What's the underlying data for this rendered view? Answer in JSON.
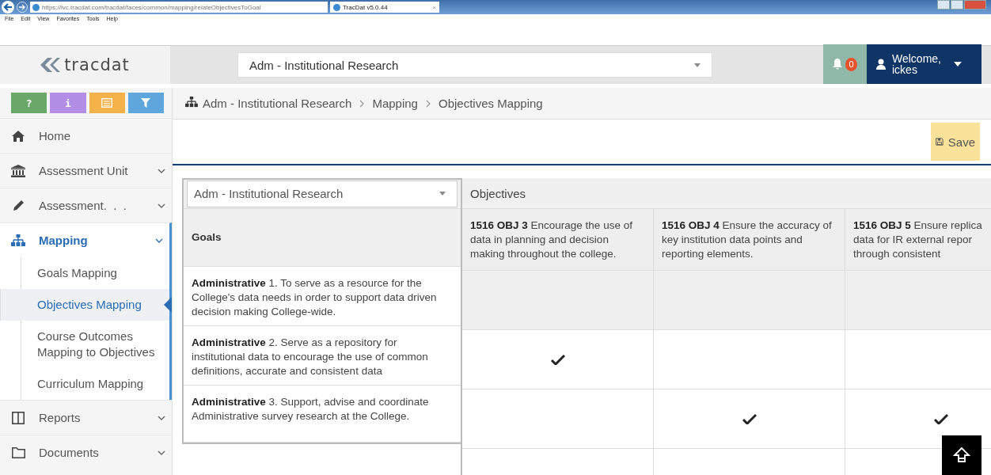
{
  "browser": {
    "url": "https://lvc.tracdat.com/tracdat/faces/common/mapping/relateObjectivesToGoal",
    "tab_title": "TracDat v5.0.44",
    "tab_close": "×",
    "menu": [
      "File",
      "Edit",
      "View",
      "Favorites",
      "Tools",
      "Help"
    ]
  },
  "header": {
    "logo": "tracdat",
    "unit_select": "Adm - Institutional Research",
    "notification_count": "0",
    "welcome": "Welcome,",
    "user": "ickes"
  },
  "tool_buttons": [
    {
      "kind": "help",
      "label": "?",
      "color": "#6aa86a"
    },
    {
      "kind": "info",
      "label": "i",
      "color": "#b38ee6"
    },
    {
      "kind": "list",
      "color": "#f6b24a"
    },
    {
      "kind": "filter",
      "color": "#5fa6dc"
    }
  ],
  "nav": [
    {
      "label": "Home",
      "expandable": false,
      "selected": false
    },
    {
      "label": "Assessment Unit",
      "expandable": true,
      "expanded": false,
      "selected": false
    },
    {
      "label": "Assessment.  .  .",
      "expandable": true,
      "expanded": false,
      "selected": false
    },
    {
      "label": "Mapping",
      "expandable": true,
      "expanded": true,
      "selected": true,
      "children": [
        {
          "label": "Goals Mapping",
          "selected": false
        },
        {
          "label": "Objectives Mapping",
          "selected": true
        },
        {
          "label": "Course Outcomes Mapping to Objectives",
          "selected": false
        },
        {
          "label": "Curriculum Mapping",
          "selected": false
        }
      ]
    },
    {
      "label": "Reports",
      "expandable": true,
      "expanded": false,
      "selected": false
    },
    {
      "label": "Documents",
      "expandable": true,
      "expanded": false,
      "selected": false
    }
  ],
  "breadcrumb": [
    "Adm - Institutional Research",
    "Mapping",
    "Objectives Mapping"
  ],
  "save_button": "Save",
  "matrix": {
    "unit_select": "Adm - Institutional Research",
    "objectives_header": "Objectives",
    "goals_header": "Goals",
    "columns": [
      {
        "code": "1516 OBJ 3",
        "lines": [
          "Encourage the use of",
          "data in planning and decision",
          "making throughout the college."
        ]
      },
      {
        "code": "1516 OBJ 4",
        "lines": [
          "Ensure the accuracy of",
          "key institution data points and",
          "reporting elements."
        ]
      },
      {
        "code": "1516 OBJ 5",
        "lines": [
          "Ensure replica",
          "data for IR external repor",
          "through consistent"
        ]
      }
    ],
    "rows": [
      {
        "category": "Administrative",
        "lines": [
          "1. To serve as a resource for the",
          "College's data needs in order to support data driven",
          "decision making College-wide."
        ],
        "marks": [
          false,
          false,
          false
        ]
      },
      {
        "category": "Administrative",
        "lines": [
          "2. Serve as a repository for",
          "institutional data to encourage the use of common",
          "definitions, accurate and consistent data"
        ],
        "marks": [
          true,
          false,
          false
        ]
      },
      {
        "category": "Administrative",
        "lines": [
          "3. Support, advise and coordinate",
          "Administrative survey research at the College."
        ],
        "marks": [
          false,
          true,
          true
        ]
      }
    ]
  }
}
